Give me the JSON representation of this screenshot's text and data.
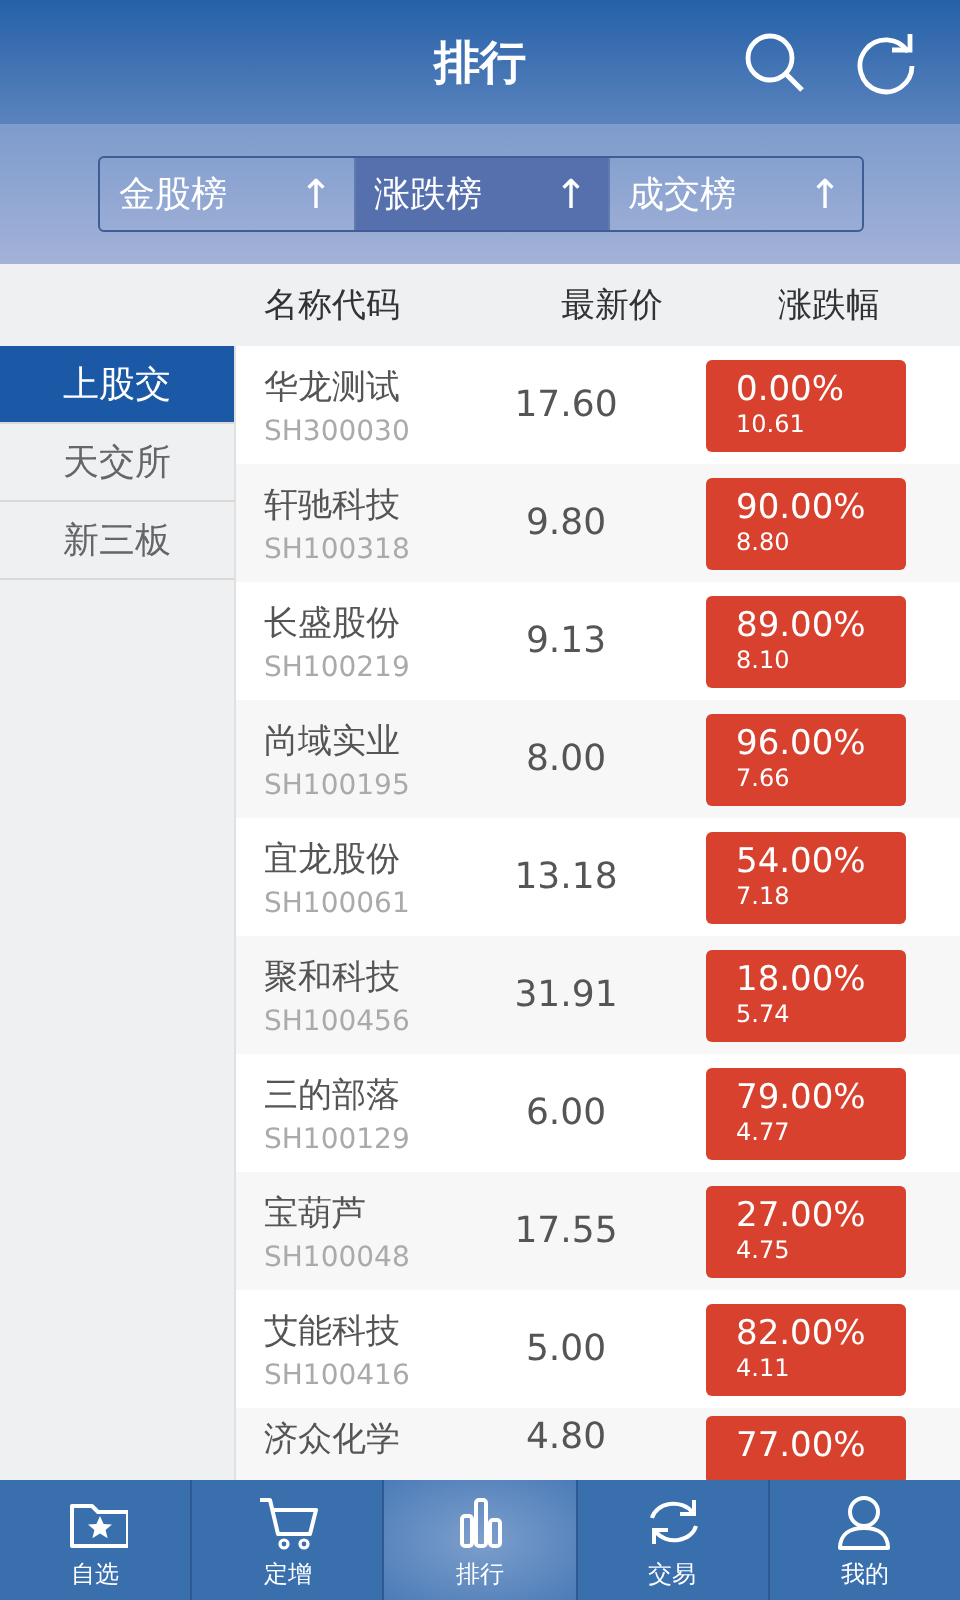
{
  "header": {
    "title": "排行"
  },
  "tabs": [
    {
      "label": "金股榜",
      "arrow": "↑",
      "selected": false
    },
    {
      "label": "涨跌榜",
      "arrow": "↑",
      "selected": true
    },
    {
      "label": "成交榜",
      "arrow": "↑",
      "selected": false
    }
  ],
  "columns": [
    "名称代码",
    "最新价",
    "涨跌幅"
  ],
  "sidebar": {
    "items": [
      {
        "label": "上股交",
        "selected": true
      },
      {
        "label": "天交所",
        "selected": false
      },
      {
        "label": "新三板",
        "selected": false
      }
    ]
  },
  "rows": [
    {
      "name": "华龙测试",
      "code": "SH300030",
      "price": "17.60",
      "change": "0.00%",
      "sub": "10.61"
    },
    {
      "name": "轩驰科技",
      "code": "SH100318",
      "price": "9.80",
      "change": "90.00%",
      "sub": "8.80"
    },
    {
      "name": "长盛股份",
      "code": "SH100219",
      "price": "9.13",
      "change": "89.00%",
      "sub": "8.10"
    },
    {
      "name": "尚域实业",
      "code": "SH100195",
      "price": "8.00",
      "change": "96.00%",
      "sub": "7.66"
    },
    {
      "name": "宜龙股份",
      "code": "SH100061",
      "price": "13.18",
      "change": "54.00%",
      "sub": "7.18"
    },
    {
      "name": "聚和科技",
      "code": "SH100456",
      "price": "31.91",
      "change": "18.00%",
      "sub": "5.74"
    },
    {
      "name": "三的部落",
      "code": "SH100129",
      "price": "6.00",
      "change": "79.00%",
      "sub": "4.77"
    },
    {
      "name": "宝葫芦",
      "code": "SH100048",
      "price": "17.55",
      "change": "27.00%",
      "sub": "4.75"
    },
    {
      "name": "艾能科技",
      "code": "SH100416",
      "price": "5.00",
      "change": "82.00%",
      "sub": "4.11"
    },
    {
      "name": "济众化学",
      "price": "4.80",
      "change": "77.00%"
    }
  ],
  "nav": [
    {
      "label": "自选",
      "kind": "watchlist",
      "selected": false
    },
    {
      "label": "定增",
      "kind": "cart",
      "selected": false
    },
    {
      "label": "排行",
      "kind": "ranking",
      "selected": true
    },
    {
      "label": "交易",
      "kind": "trade",
      "selected": false
    },
    {
      "label": "我的",
      "kind": "profile",
      "selected": false
    }
  ]
}
